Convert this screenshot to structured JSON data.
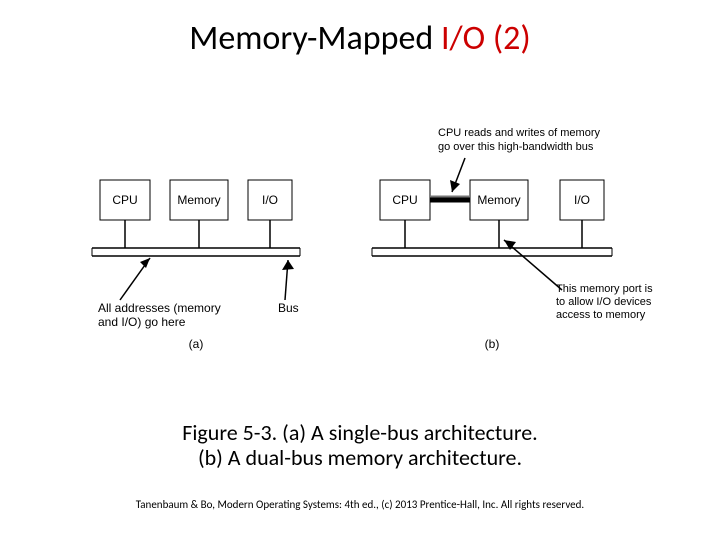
{
  "title": {
    "black1": "Memory-Mapped ",
    "red": "I/O (2)"
  },
  "diagram": {
    "a": {
      "boxes": [
        "CPU",
        "Memory",
        "I/O"
      ],
      "note_line1": "All addresses (memory",
      "note_line2": "and I/O) go here",
      "bus_label": "Bus",
      "sub_label": "(a)"
    },
    "b": {
      "boxes": [
        "CPU",
        "Memory",
        "I/O"
      ],
      "top_note_line1": "CPU reads and writes of memory",
      "top_note_line2": "go over this high-bandwidth bus",
      "side_note_line1": "This memory port is",
      "side_note_line2": "to allow I/O devices",
      "side_note_line3": "access to memory",
      "sub_label": "(b)"
    }
  },
  "caption": {
    "line1": "Figure 5-3. (a) A single-bus architecture.",
    "line2": "(b) A dual-bus memory architecture."
  },
  "footer": "Tanenbaum & Bo, Modern Operating Systems: 4th ed., (c) 2013 Prentice-Hall, Inc. All rights reserved."
}
